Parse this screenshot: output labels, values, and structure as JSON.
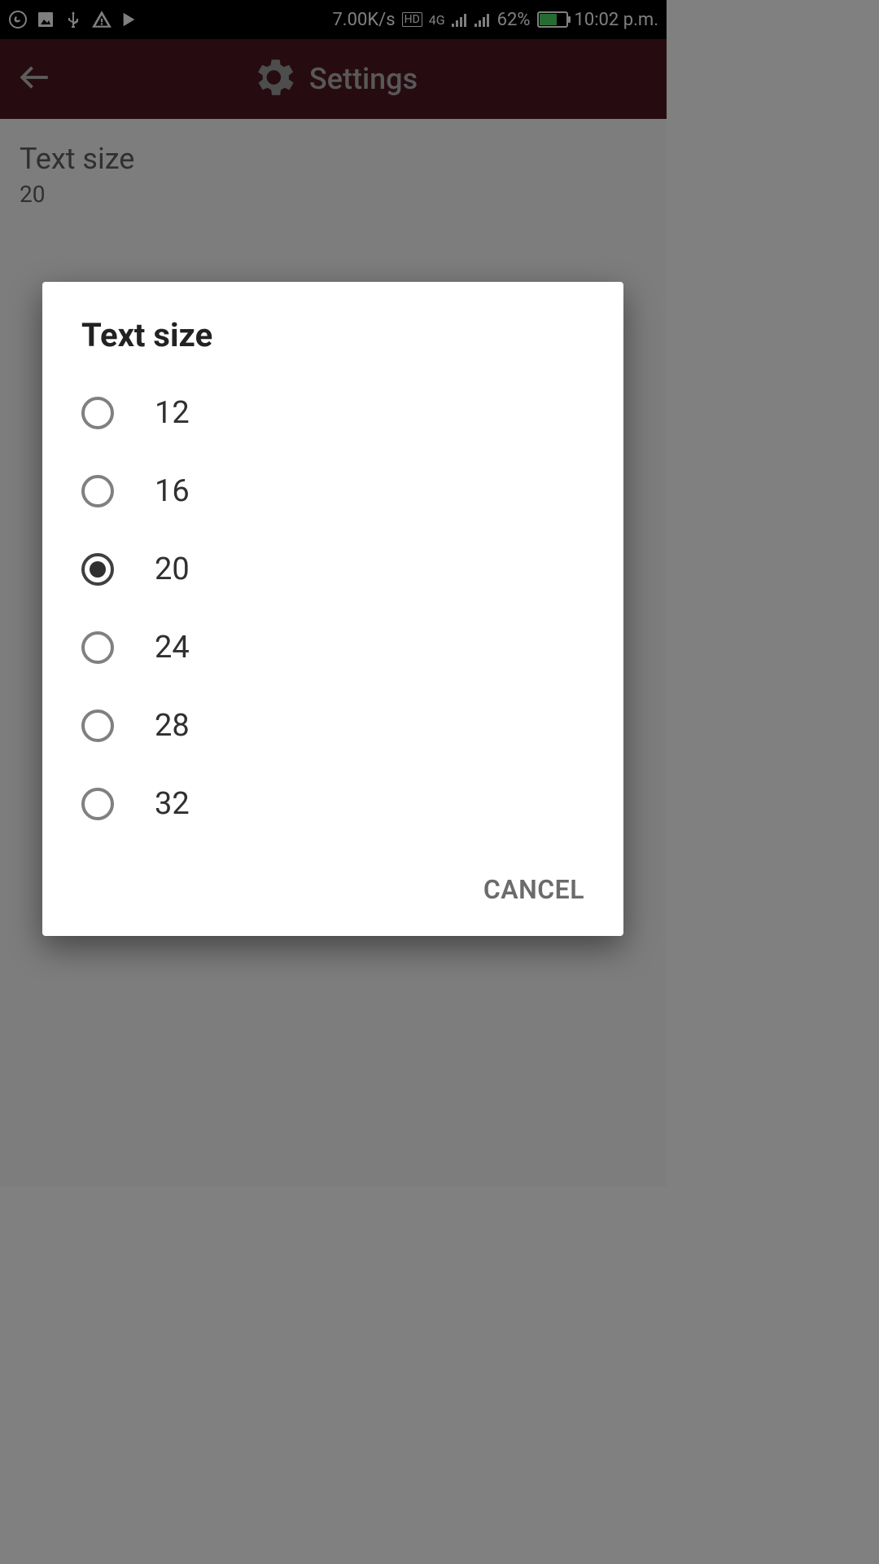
{
  "status_bar": {
    "data_speed": "7.00K/s",
    "network_label": "4G",
    "hd_label": "HD",
    "battery_percent": "62%",
    "time": "10:02 p.m."
  },
  "header": {
    "title": "Settings"
  },
  "page": {
    "setting_title": "Text size",
    "setting_value": "20"
  },
  "dialog": {
    "title": "Text size",
    "options": [
      {
        "label": "12",
        "selected": false
      },
      {
        "label": "16",
        "selected": false
      },
      {
        "label": "20",
        "selected": true
      },
      {
        "label": "24",
        "selected": false
      },
      {
        "label": "28",
        "selected": false
      },
      {
        "label": "32",
        "selected": false
      }
    ],
    "cancel_label": "CANCEL"
  }
}
